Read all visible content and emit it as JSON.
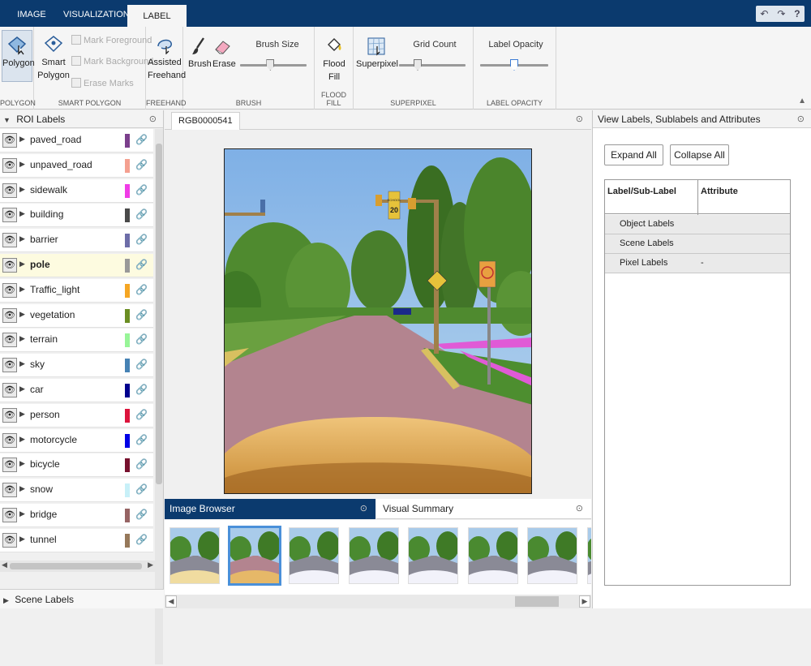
{
  "top_tabs": [
    "IMAGE LABELER",
    "VISUALIZATION",
    "LABEL PIXELS"
  ],
  "ribbon": {
    "polygon": {
      "button": "Polygon",
      "section": "POLYGON"
    },
    "smart_polygon": {
      "button": "Smart Polygon",
      "mark_foreground": "Mark Foreground",
      "mark_background": "Mark Background",
      "erase_marks": "Erase Marks",
      "section": "SMART POLYGON"
    },
    "freehand": {
      "button": "Assisted Freehand",
      "section": "FREEHAND"
    },
    "brush": {
      "brush": "Brush",
      "erase": "Erase",
      "brush_size": "Brush Size",
      "brush_size_level": 0.45,
      "section": "BRUSH"
    },
    "flood_fill": {
      "button": "Flood Fill",
      "section": "FLOOD FILL"
    },
    "superpixel": {
      "button": "Superpixel",
      "grid_count": "Grid Count",
      "grid_count_level": 0.25,
      "section": "SUPERPIXEL"
    },
    "label_opacity": {
      "label": "Label Opacity",
      "level": 0.5,
      "section": "LABEL OPACITY"
    }
  },
  "roi_panel": {
    "title": "ROI Labels",
    "labels": [
      {
        "name": "paved_road",
        "color": "#7b3f8c"
      },
      {
        "name": "unpaved_road",
        "color": "#f4a090"
      },
      {
        "name": "sidewalk",
        "color": "#f03ce6"
      },
      {
        "name": "building",
        "color": "#4a4a4a"
      },
      {
        "name": "barrier",
        "color": "#6d6da8"
      },
      {
        "name": "pole",
        "color": "#999999",
        "selected": true
      },
      {
        "name": "Traffic_light",
        "color": "#f5a623"
      },
      {
        "name": "vegetation",
        "color": "#6b8e23"
      },
      {
        "name": "terrain",
        "color": "#98f598"
      },
      {
        "name": "sky",
        "color": "#4682b4"
      },
      {
        "name": "car",
        "color": "#00008e"
      },
      {
        "name": "person",
        "color": "#dc143c"
      },
      {
        "name": "motorcycle",
        "color": "#0000e6"
      },
      {
        "name": "bicycle",
        "color": "#77112e"
      },
      {
        "name": "snow",
        "color": "#c8f0f8"
      },
      {
        "name": "bridge",
        "color": "#966464"
      },
      {
        "name": "tunnel",
        "color": "#96785a"
      }
    ]
  },
  "scene_labels": "Scene Labels",
  "document_tab": "RGB0000541",
  "bottom": {
    "image_browser": "Image Browser",
    "visual_summary": "Visual Summary",
    "thumbnail_count": 8,
    "selected_thumbnail": 2
  },
  "right_panel": {
    "title": "View Labels, Sublabels and Attributes",
    "expand_all": "Expand All",
    "collapse_all": "Collapse All",
    "col_label": "Label/Sub-Label",
    "col_attribute": "Attribute",
    "rows": [
      {
        "label": "Object Labels",
        "attribute": ""
      },
      {
        "label": "Scene Labels",
        "attribute": ""
      },
      {
        "label": "Pixel Labels",
        "attribute": "-"
      }
    ]
  },
  "road_sign_text": [
    "SCHOOL",
    "20"
  ]
}
